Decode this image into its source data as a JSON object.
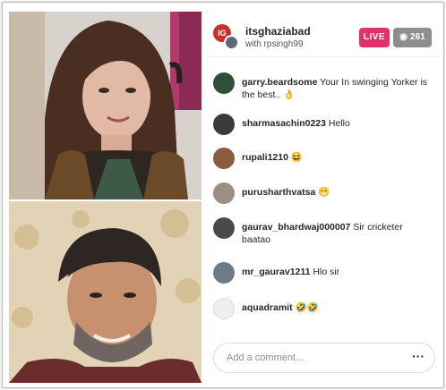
{
  "header": {
    "host_username": "itsghaziabad",
    "with_text": "with rpsingh99",
    "host_avatar_initials": "IG",
    "live_label": "LIVE",
    "viewer_count": "261",
    "viewer_icon": "eye-icon"
  },
  "comments": [
    {
      "user": "garry.beardsome",
      "text": "Your In swinging Yorker is the best.. 👌",
      "avatar_color": "#2f4f3a"
    },
    {
      "user": "sharmasachin0223",
      "text": "Hello",
      "avatar_color": "#3b3b3b"
    },
    {
      "user": "rupali1210",
      "text": "😆",
      "avatar_color": "#8a5b3f"
    },
    {
      "user": "purusharthvatsa",
      "text": "😁",
      "avatar_color": "#9a8f85"
    },
    {
      "user": "gaurav_bhardwaj000007",
      "text": "Sir cricketer baatao",
      "avatar_color": "#4a4a4a"
    },
    {
      "user": "mr_gaurav1211",
      "text": "Hlo sir",
      "avatar_color": "#6e7a86"
    },
    {
      "user": "aquadramit",
      "text": "🤣🤣",
      "avatar_color": "#efefef"
    }
  ],
  "composer": {
    "placeholder": "Add a comment...",
    "more_label": "···"
  },
  "colors": {
    "live_badge": "#e1306c",
    "viewer_badge": "#8e8e8e",
    "text_primary": "#262626"
  }
}
